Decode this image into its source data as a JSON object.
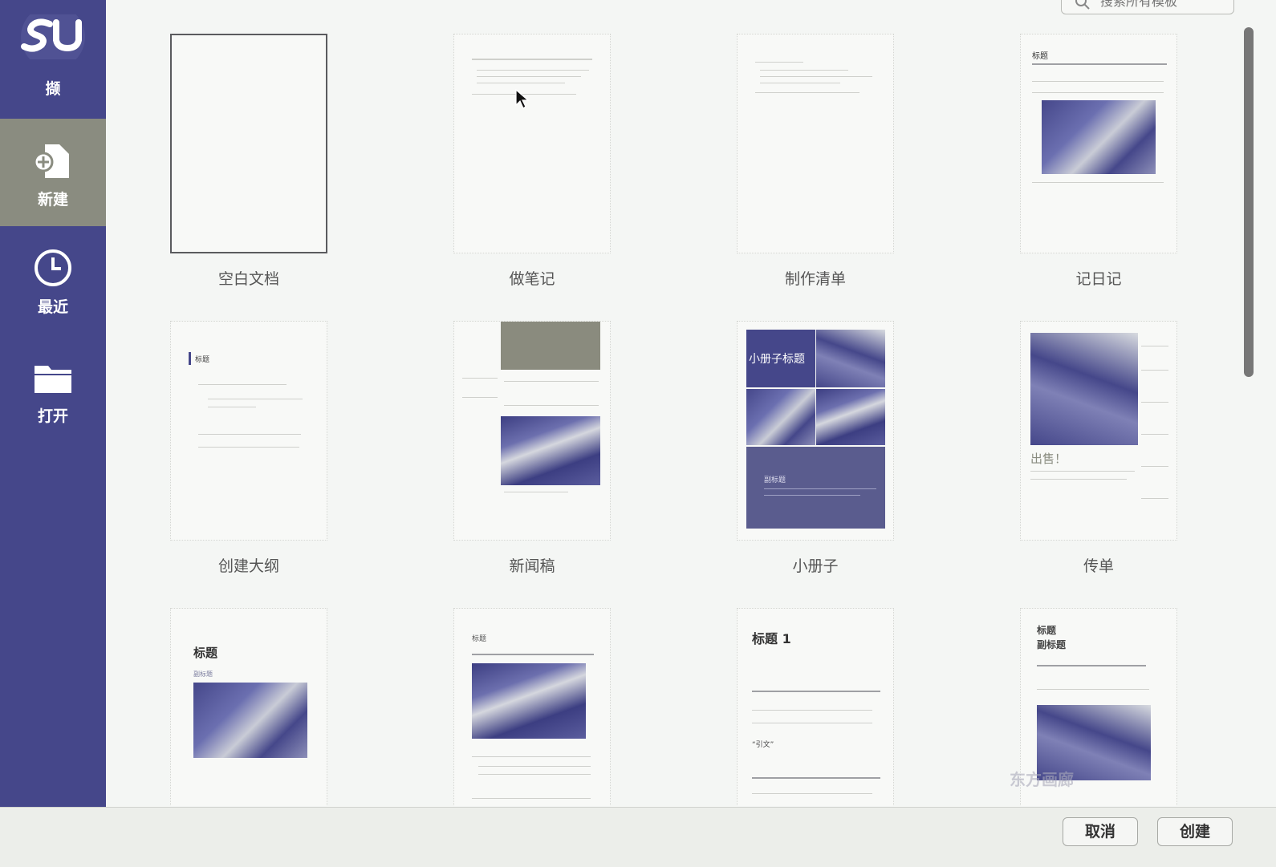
{
  "sidebar": {
    "logo_text": "撷",
    "items": [
      {
        "label": "新建",
        "icon": "new-document-icon"
      },
      {
        "label": "最近",
        "icon": "clock-icon"
      },
      {
        "label": "打开",
        "icon": "folder-icon"
      }
    ]
  },
  "search": {
    "placeholder": "搜索所有模板"
  },
  "templates": [
    {
      "label": "空白文档"
    },
    {
      "label": "做笔记"
    },
    {
      "label": "制作清单"
    },
    {
      "label": "记日记"
    },
    {
      "label": "创建大纲"
    },
    {
      "label": "新闻稿"
    },
    {
      "label": "小册子"
    },
    {
      "label": "传单"
    },
    {
      "label": ""
    },
    {
      "label": ""
    },
    {
      "label": ""
    },
    {
      "label": ""
    }
  ],
  "previews": {
    "diary_title": "标题",
    "outline_heading": "标题",
    "brochure_title": "小册子标题",
    "brochure_sub": "副标题",
    "flyer_sale": "出售！",
    "report_title": "标题",
    "report_sub": "副标题",
    "story_title": "标题",
    "heading1": "标题 1",
    "quote": "“引文”",
    "poster_title": "标题",
    "poster_sub": "副标题"
  },
  "footer": {
    "cancel_label": "取消",
    "create_label": "创建"
  },
  "watermark": "东方画廊",
  "colors": {
    "sidebar": "#45478a",
    "selected_nav": "#8a8c80",
    "background": "#f4f6f4"
  }
}
